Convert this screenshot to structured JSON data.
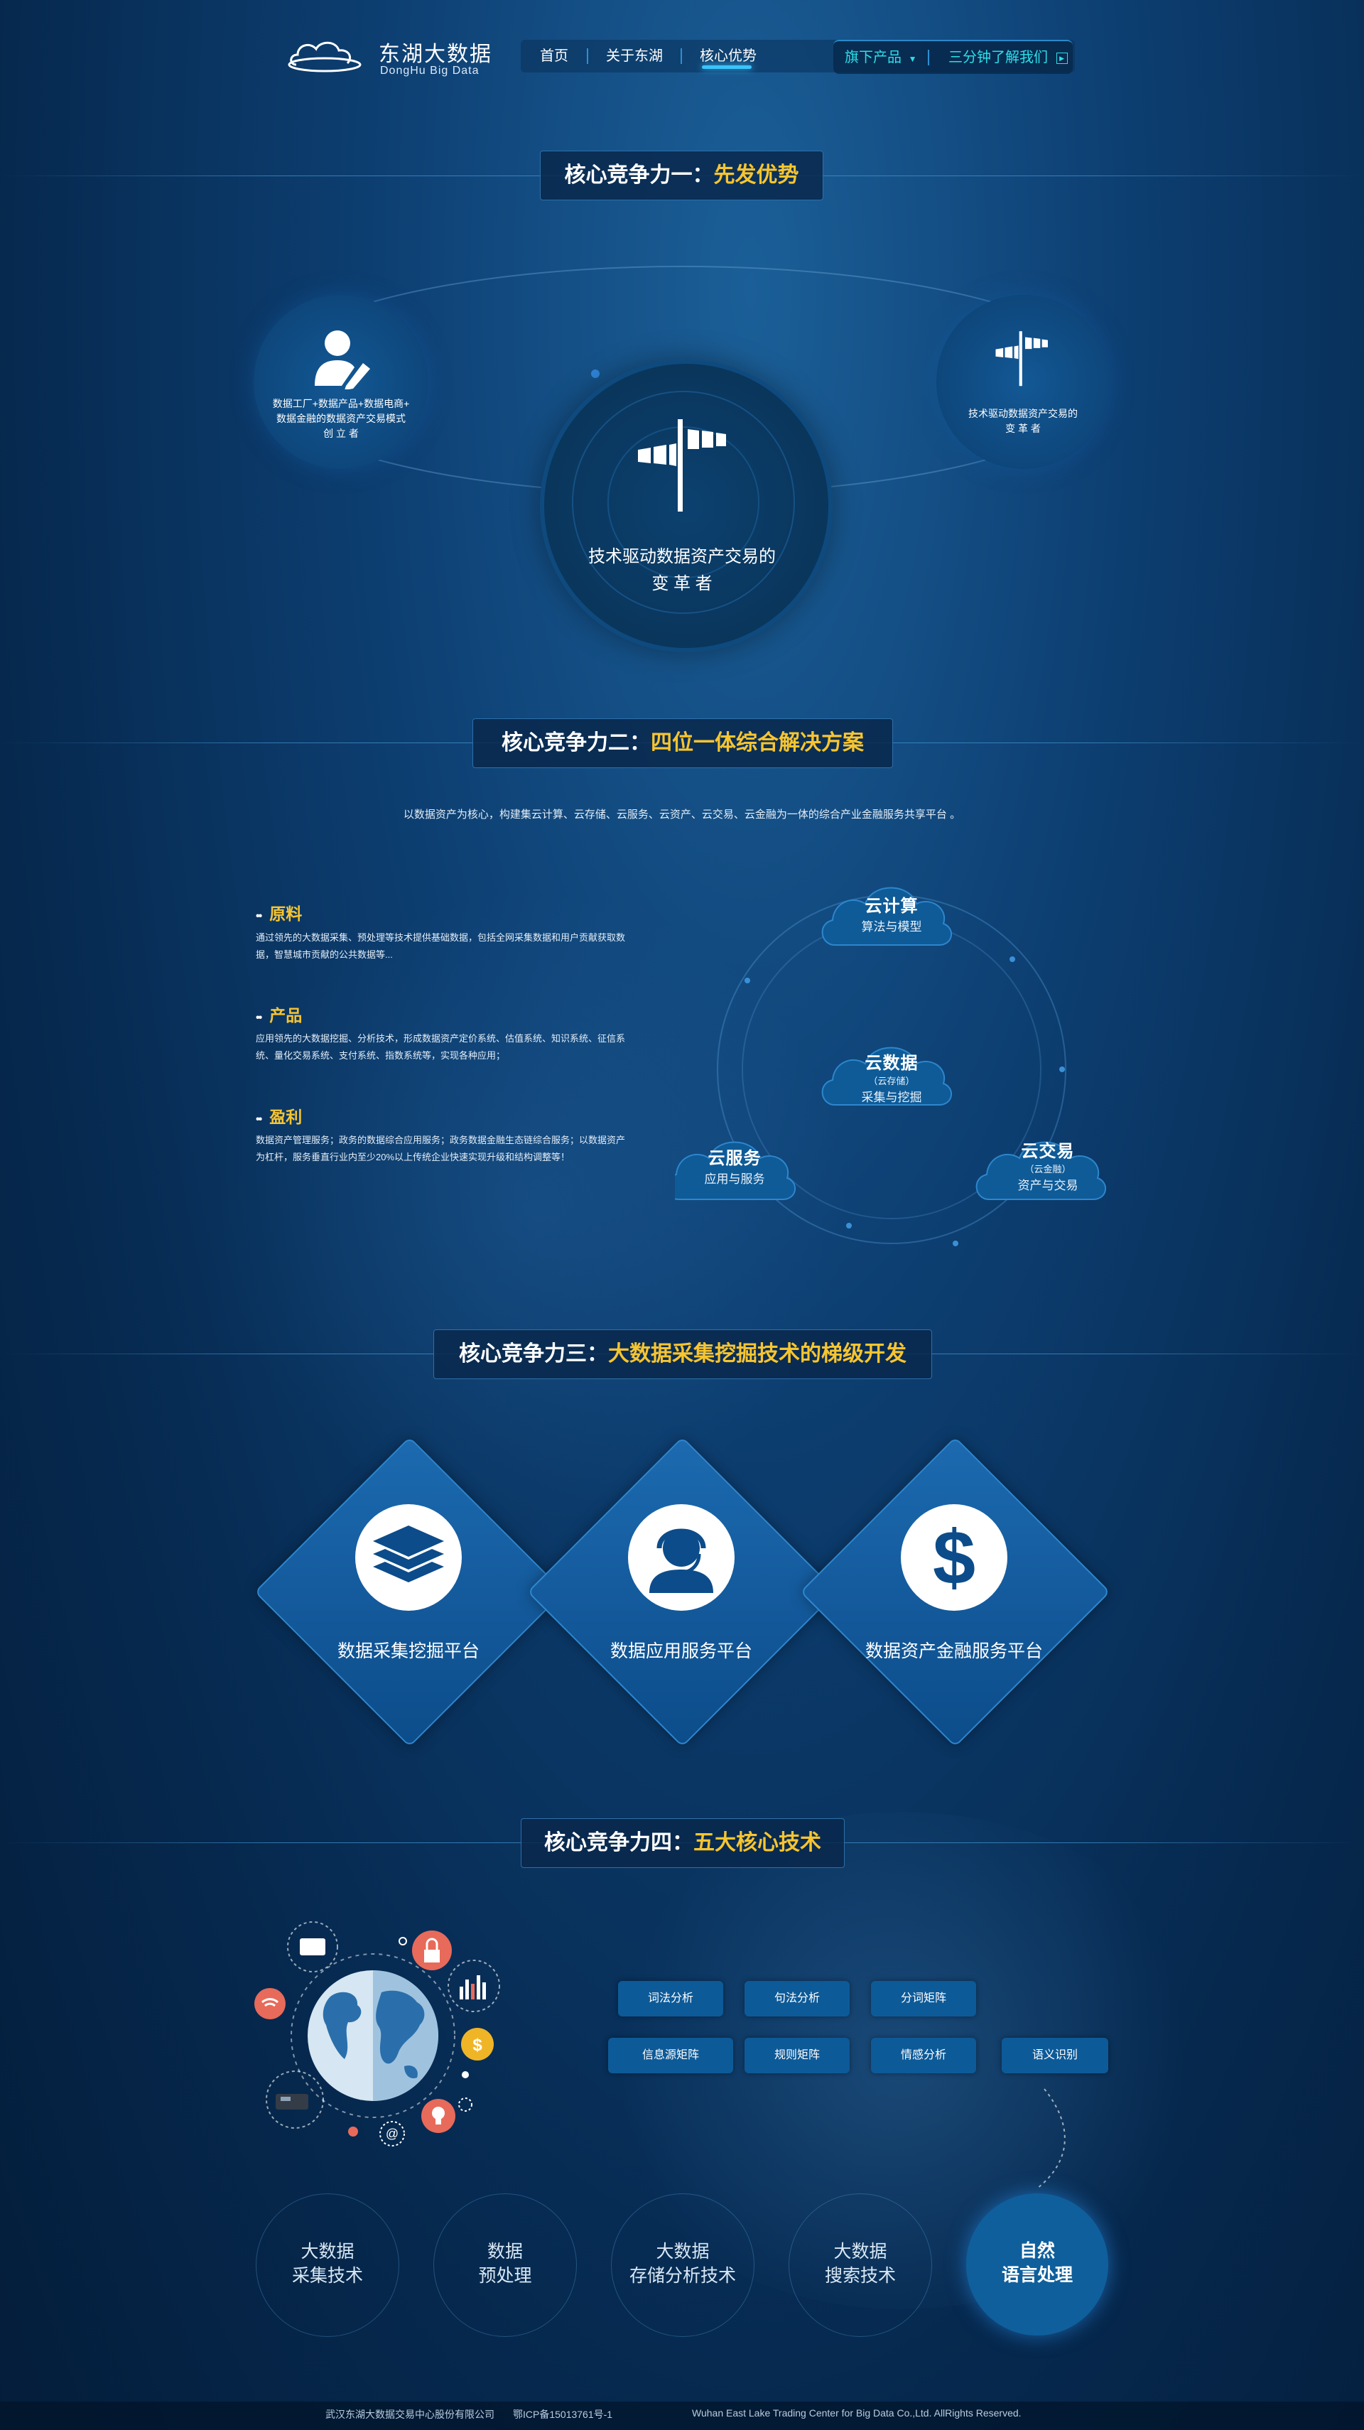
{
  "header": {
    "logo_cn": "东湖大数据",
    "logo_en": "DongHu  Big Data",
    "nav": [
      "首页",
      "关于东湖",
      "核心优势"
    ],
    "products_label": "旗下产品",
    "video_label": "三分钟了解我们"
  },
  "section1": {
    "title_prefix": "核心竞争力一：",
    "title_highlight": "先发优势",
    "left_text": [
      "数据工厂+数据产品+数据电商+",
      "数据金融的数据资产交易模式",
      "创 立 者"
    ],
    "center_text": [
      "技术驱动数据资产交易的",
      "变 革 者"
    ],
    "right_text": [
      "技术驱动数据资产交易的",
      "变 革 者"
    ]
  },
  "section2": {
    "title_prefix": "核心竞争力二：",
    "title_highlight": "四位一体综合解决方案",
    "intro": "以数据资产为核心，构建集云计算、云存储、云服务、云资产、云交易、云金融为一体的综合产业金融服务共享平台 。",
    "features": [
      {
        "title": "原料",
        "text": [
          "通过领先的大数据采集、预处理等技术提供基础数据，包括全网采集数据和用户贡献获取数",
          "据，智慧城市贡献的公共数据等..."
        ]
      },
      {
        "title": "产品",
        "text": [
          "应用领先的大数据挖掘、分析技术，形成数据资产定价系统、估值系统、知识系统、征信系",
          "统、量化交易系统、支付系统、指数系统等，实现各种应用；"
        ]
      },
      {
        "title": "盈利",
        "text": [
          "数据资产管理服务；政务的数据综合应用服务；政务数据金融生态链综合服务；以数据资产",
          "为杠杆，服务垂直行业内至少20%以上传统企业快速实现升级和结构调整等！"
        ]
      }
    ],
    "clouds": {
      "top": {
        "title": "云计算",
        "desc": "算法与模型"
      },
      "center": {
        "title": "云数据",
        "sub": "（云存储）",
        "desc": "采集与挖掘"
      },
      "left": {
        "title": "云服务",
        "desc": "应用与服务"
      },
      "right": {
        "title": "云交易",
        "sub": "（云金融）",
        "desc": "资产与交易"
      }
    }
  },
  "section3": {
    "title_prefix": "核心竞争力三：",
    "title_highlight": "大数据采集挖掘技术的梯级开发",
    "platforms": [
      "数据采集挖掘平台",
      "数据应用服务平台",
      "数据资产金融服务平台"
    ]
  },
  "section4": {
    "title_prefix": "核心竞争力四：",
    "title_highlight": "五大核心技术",
    "tags_row1": [
      "词法分析",
      "句法分析",
      "分词矩阵"
    ],
    "tags_row2": [
      "信息源矩阵",
      "规则矩阵",
      "情感分析",
      "语义识别"
    ],
    "techs": [
      [
        "大数据",
        "采集技术"
      ],
      [
        "数据",
        "预处理"
      ],
      [
        "大数据",
        "存储分析技术"
      ],
      [
        "大数据",
        "搜索技术"
      ],
      [
        "自然",
        "语言处理"
      ]
    ]
  },
  "footer": {
    "company": "武汉东湖大数据交易中心股份有限公司",
    "icp": "鄂ICP备15013761号-1",
    "copyright": "Wuhan East Lake Trading Center for Big Data Co.,Ltd. AllRights Reserved."
  },
  "colors": {
    "accent_yellow": "#f7c530",
    "accent_cyan": "#2cdfe9",
    "navy": "#0c4c8a"
  }
}
